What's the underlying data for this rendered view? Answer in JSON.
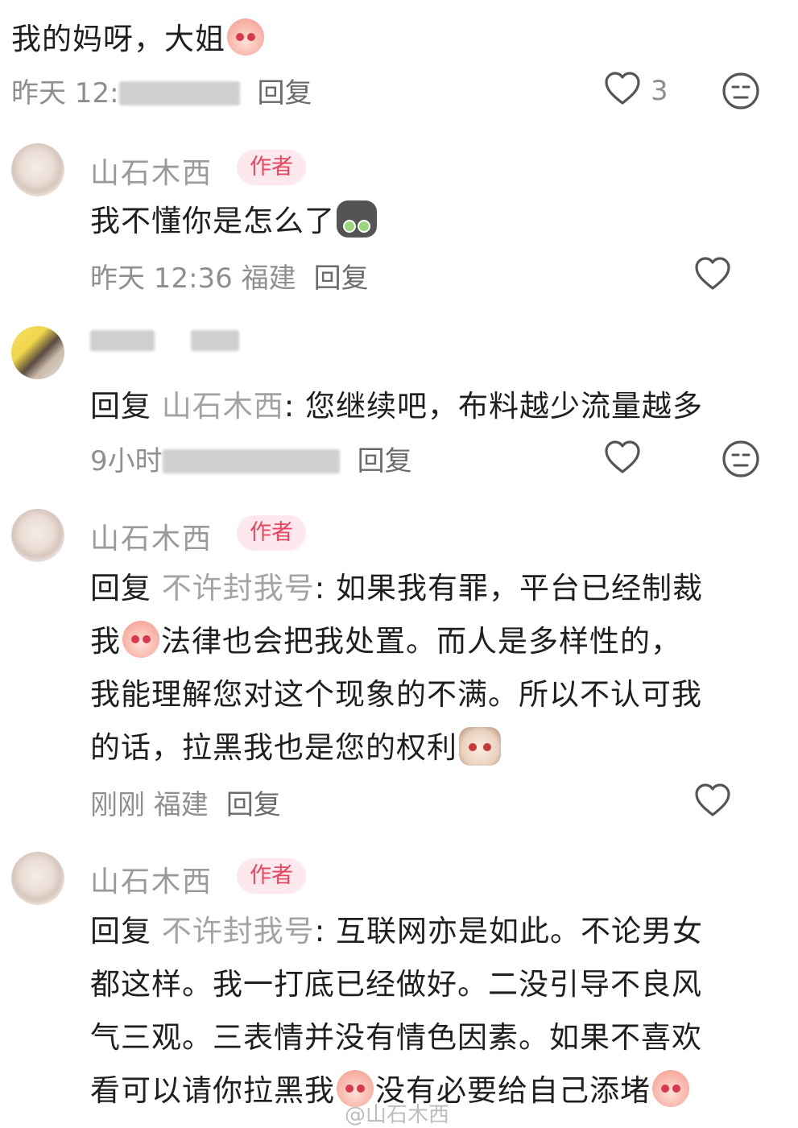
{
  "top": {
    "text": "我的妈呀，大姐",
    "meta_time": "昨天 12:",
    "meta_reply": "回复",
    "like_count": "3"
  },
  "comments": [
    {
      "author": "山石木西",
      "badge": "作者",
      "text_lines": [
        "我不懂你是怎么了"
      ],
      "meta_time": "昨天 12:36 福建",
      "meta_reply": "回复"
    },
    {
      "author": "",
      "reply_label": "回复",
      "mention": "山石木西",
      "text_lines": [
        "您继续吧，布料越少流量越多"
      ],
      "meta_time": "9小时",
      "meta_reply": "回复"
    },
    {
      "author": "山石木西",
      "badge": "作者",
      "reply_label": "回复",
      "mention": "不许封我号",
      "text_lines": [
        "如果我有罪，平台已经制裁",
        "我",
        "法律也会把我处置。而人是多样性的，",
        "我能理解您对这个现象的不满。所以不认可我",
        "的话，拉黑我也是您的权利"
      ],
      "meta_time": "刚刚 福建",
      "meta_reply": "回复"
    },
    {
      "author": "山石木西",
      "badge": "作者",
      "reply_label": "回复",
      "mention": "不许封我号",
      "text_lines": [
        "互联网亦是如此。不论男女",
        "都这样。我一打底已经做好。二没引导不良风",
        "气三观。三表情并没有情色因素。如果不喜欢",
        "看可以请你拉黑我",
        "没有必要给自己添堵"
      ]
    }
  ],
  "watermark": "@山石木西",
  "icons": [
    "heart-outline-icon",
    "meh-face-icon"
  ],
  "colors": {
    "badge_bg": "#fde8ee",
    "badge_text": "#e8455f",
    "muted": "#8f8f8f",
    "mention": "#a3a3a3"
  }
}
